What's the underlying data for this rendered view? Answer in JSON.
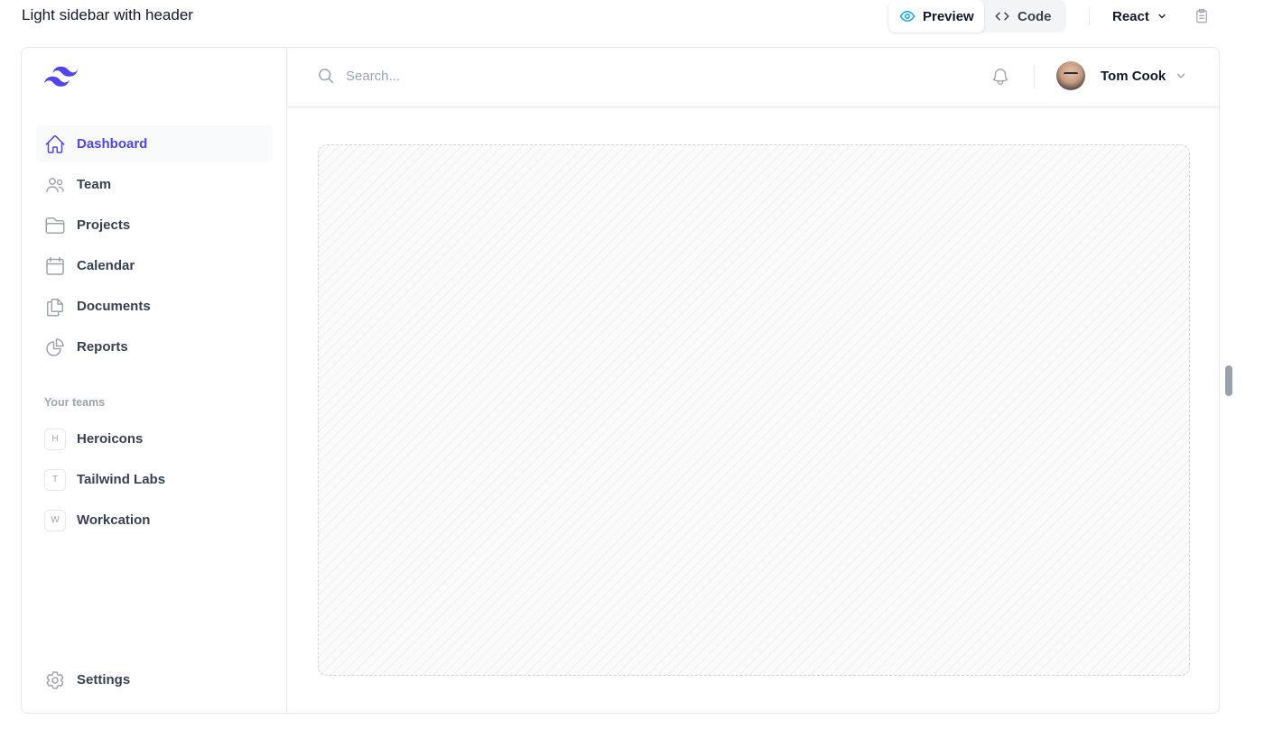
{
  "page": {
    "title": "Light sidebar with header"
  },
  "view_toggle": {
    "preview_label": "Preview",
    "code_label": "Code",
    "active": "Preview"
  },
  "framework_select": {
    "value": "React"
  },
  "app": {
    "brand_color": "#4f46e5",
    "sidebar": {
      "nav": [
        {
          "label": "Dashboard",
          "icon": "home-icon",
          "active": true
        },
        {
          "label": "Team",
          "icon": "users-icon"
        },
        {
          "label": "Projects",
          "icon": "folder-icon"
        },
        {
          "label": "Calendar",
          "icon": "calendar-icon"
        },
        {
          "label": "Documents",
          "icon": "documents-icon"
        },
        {
          "label": "Reports",
          "icon": "chart-pie-icon"
        }
      ],
      "teams_heading": "Your teams",
      "teams": [
        {
          "initial": "H",
          "name": "Heroicons"
        },
        {
          "initial": "T",
          "name": "Tailwind Labs"
        },
        {
          "initial": "W",
          "name": "Workcation"
        }
      ],
      "settings_label": "Settings"
    },
    "header": {
      "search_placeholder": "Search...",
      "search_value": "",
      "user_name": "Tom Cook"
    }
  }
}
